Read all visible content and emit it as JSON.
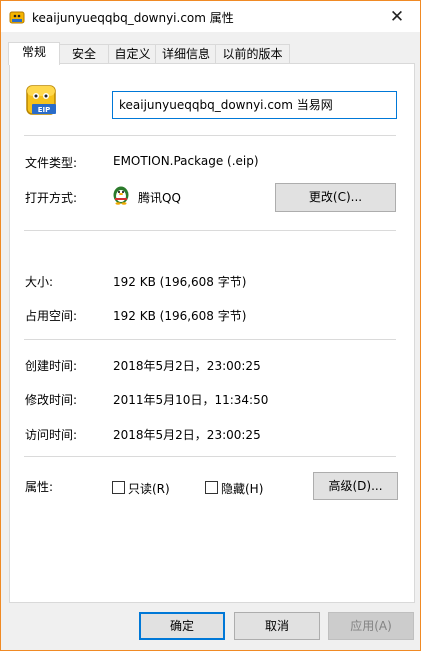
{
  "window": {
    "title": "keaijunyueqqbq_downyi.com 属性",
    "close_glyph": "✕"
  },
  "tabs": [
    {
      "label": "常规",
      "active": true
    },
    {
      "label": "安全",
      "active": false
    },
    {
      "label": "自定义",
      "active": false
    },
    {
      "label": "详细信息",
      "active": false
    },
    {
      "label": "以前的版本",
      "active": false
    }
  ],
  "general": {
    "file_icon": "eip-file-icon",
    "file_icon_text": "EIP",
    "file_name": "keaijunyueqqbq_downyi.com  当易网",
    "file_type_label": "文件类型:",
    "file_type_value": "EMOTION.Package (.eip)",
    "opens_with_label": "打开方式:",
    "opens_with_app": "腾讯QQ",
    "opens_with_app_icon": "qq-penguin-icon",
    "change_button": "更改(C)...",
    "size_label": "大小:",
    "size_value": "192 KB (196,608 字节)",
    "size_on_disk_label": "占用空间:",
    "size_on_disk_value": "192 KB (196,608 字节)",
    "created_label": "创建时间:",
    "created_value": "2018年5月2日，23:00:25",
    "modified_label": "修改时间:",
    "modified_value": "2011年5月10日，11:34:50",
    "accessed_label": "访问时间:",
    "accessed_value": "2018年5月2日，23:00:25",
    "attributes_label": "属性:",
    "readonly_label": "只读(R)",
    "readonly_checked": false,
    "hidden_label": "隐藏(H)",
    "hidden_checked": false,
    "advanced_button": "高级(D)..."
  },
  "footer": {
    "ok_button": "确定",
    "cancel_button": "取消",
    "apply_button": "应用(A)"
  },
  "colors": {
    "accent": "#0078d7",
    "window_border": "#f08a24"
  }
}
